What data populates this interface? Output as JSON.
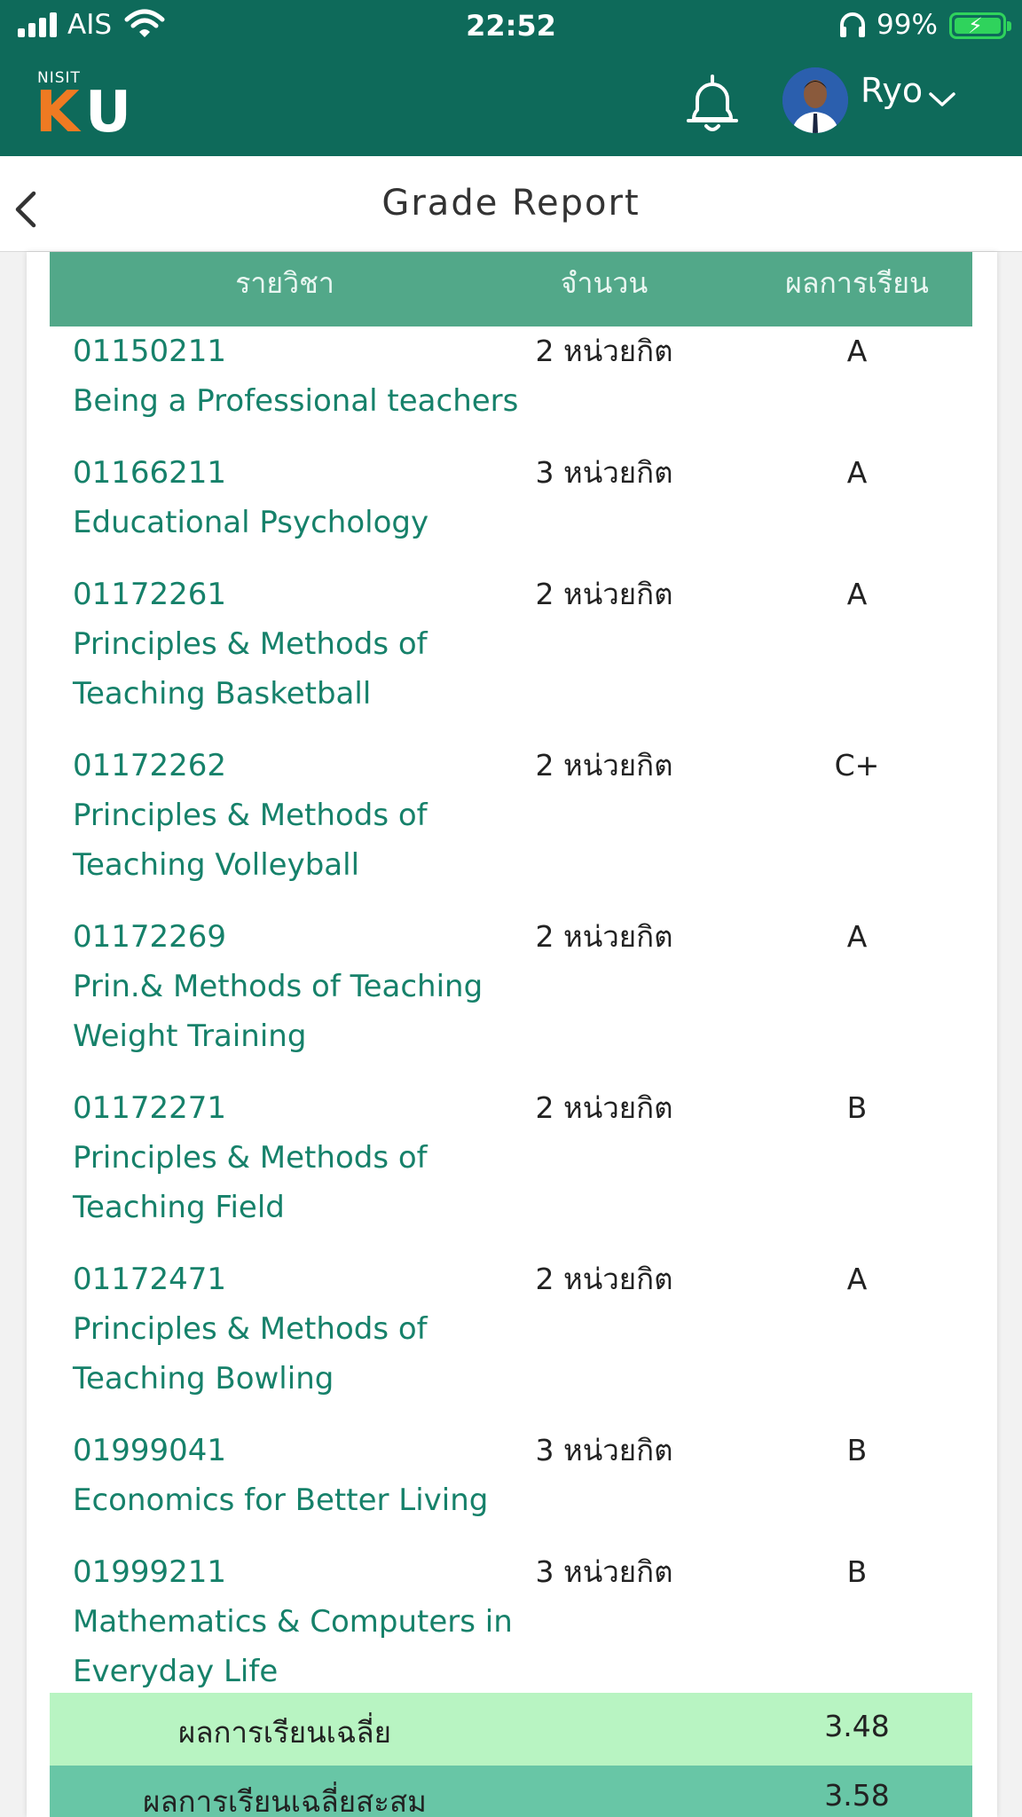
{
  "status_bar": {
    "carrier": "AIS",
    "time": "22:52",
    "battery": "99%"
  },
  "header": {
    "logo_small": "NISIT",
    "logo_k": "K",
    "logo_u": "U",
    "username": "Ryo"
  },
  "nav": {
    "title": "Grade Report"
  },
  "table": {
    "headers": {
      "course": "รายวิชา",
      "credit": "จำนวน",
      "grade": "ผลการเรียน"
    },
    "rows": [
      {
        "code": "01150211",
        "name": "Being a Professional teachers",
        "name2": "",
        "credit": "2 หน่วยกิต",
        "grade": "A"
      },
      {
        "code": "01166211",
        "name": "Educational Psychology",
        "name2": "",
        "credit": "3 หน่วยกิต",
        "grade": "A"
      },
      {
        "code": "01172261",
        "name": "Principles & Methods of",
        "name2": "Teaching Basketball",
        "credit": "2 หน่วยกิต",
        "grade": "A"
      },
      {
        "code": "01172262",
        "name": "Principles & Methods of",
        "name2": "Teaching Volleyball",
        "credit": "2 หน่วยกิต",
        "grade": "C+"
      },
      {
        "code": "01172269",
        "name": "Prin.& Methods of Teaching",
        "name2": "Weight Training",
        "credit": "2 หน่วยกิต",
        "grade": "A"
      },
      {
        "code": "01172271",
        "name": "Principles & Methods of",
        "name2": "Teaching Field",
        "credit": "2 หน่วยกิต",
        "grade": "B"
      },
      {
        "code": "01172471",
        "name": "Principles & Methods of",
        "name2": "Teaching Bowling",
        "credit": "2 หน่วยกิต",
        "grade": "A"
      },
      {
        "code": "01999041",
        "name": "Economics for Better Living",
        "name2": "",
        "credit": "3 หน่วยกิต",
        "grade": "B"
      },
      {
        "code": "01999211",
        "name": "Mathematics & Computers in",
        "name2": "Everyday Life",
        "credit": "3 หน่วยกิต",
        "grade": "B"
      }
    ],
    "summary": {
      "label": "ผลการเรียนเฉลี่ย",
      "value": "3.48"
    },
    "cumulative": {
      "label": "ผลการเรียนเฉลี่ยสะสม",
      "value": "3.58"
    }
  },
  "colors": {
    "header_bg": "#0e6a5a",
    "table_head": "#52a889",
    "summary_bg": "#b8f4c2",
    "cumulative_bg": "#68c6a6",
    "course_text": "#16816a",
    "logo_orange": "#ef7a22"
  },
  "icons": [
    "signal-icon",
    "wifi-icon",
    "headphone-icon",
    "battery-icon",
    "bell-icon",
    "avatar",
    "chevron-down-icon",
    "back-chevron-icon"
  ]
}
